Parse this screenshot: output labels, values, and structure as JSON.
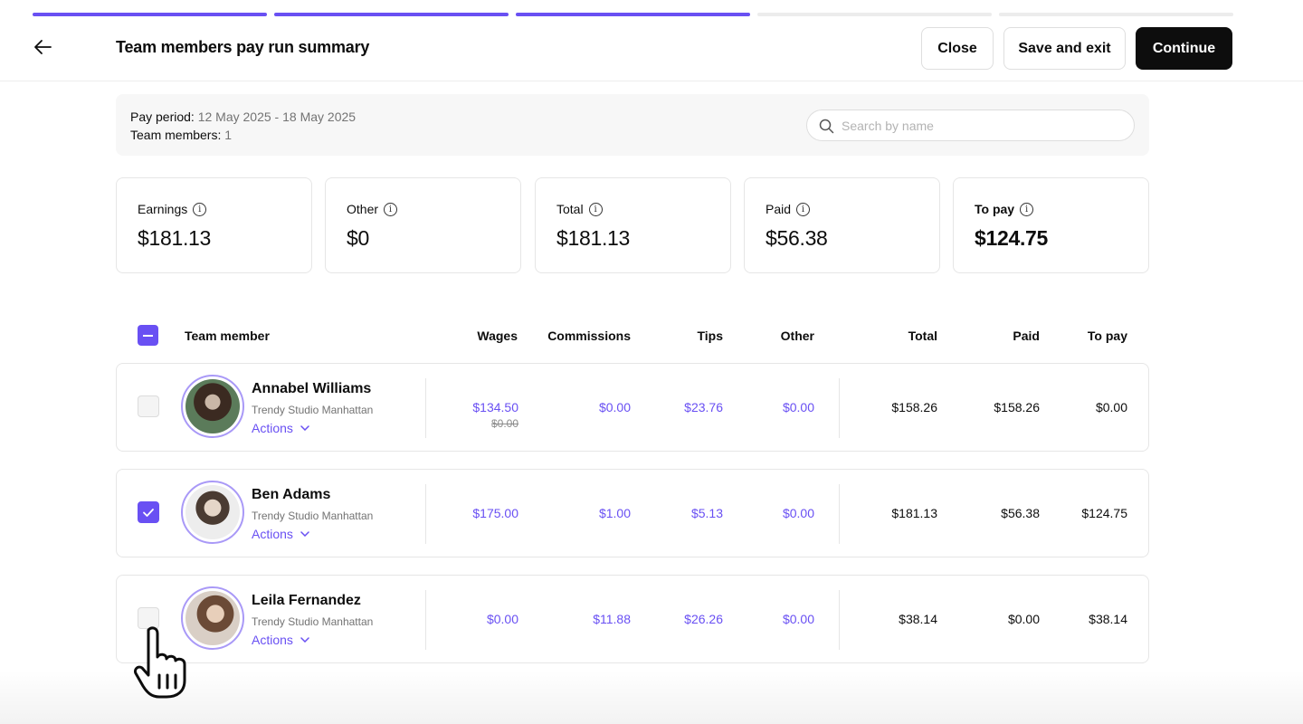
{
  "progress": {
    "total_steps": 5,
    "completed_steps": 3,
    "accent": "#6950f3"
  },
  "header": {
    "title": "Team members pay run summary",
    "back_icon": "arrow-left-icon",
    "close_label": "Close",
    "save_label": "Save and exit",
    "continue_label": "Continue"
  },
  "info": {
    "pay_period_label": "Pay period:",
    "pay_period_value": "12 May 2025 - 18 May 2025",
    "team_members_label": "Team members:",
    "team_members_value": "1",
    "search_placeholder": "Search by name"
  },
  "summary": [
    {
      "label": "Earnings",
      "value": "$181.13"
    },
    {
      "label": "Other",
      "value": "$0"
    },
    {
      "label": "Total",
      "value": "$181.13"
    },
    {
      "label": "Paid",
      "value": "$56.38"
    },
    {
      "label": "To pay",
      "value": "$124.75"
    }
  ],
  "table": {
    "columns": [
      "Team member",
      "Wages",
      "Commissions",
      "Tips",
      "Other",
      "Total",
      "Paid",
      "To pay"
    ],
    "rows": [
      {
        "checked": false,
        "name": "Annabel Williams",
        "location": "Trendy Studio Manhattan",
        "actions": "Actions",
        "wages": "$134.50",
        "wages_original": "$0.00",
        "commissions": "$0.00",
        "tips": "$23.76",
        "other": "$0.00",
        "total": "$158.26",
        "paid": "$158.26",
        "to_pay": "$0.00"
      },
      {
        "checked": true,
        "name": "Ben Adams",
        "location": "Trendy Studio Manhattan",
        "actions": "Actions",
        "wages": "$175.00",
        "commissions": "$1.00",
        "tips": "$5.13",
        "other": "$0.00",
        "total": "$181.13",
        "paid": "$56.38",
        "to_pay": "$124.75"
      },
      {
        "checked": false,
        "name": "Leila Fernandez",
        "location": "Trendy Studio Manhattan",
        "actions": "Actions",
        "wages": "$0.00",
        "commissions": "$11.88",
        "tips": "$26.26",
        "other": "$0.00",
        "total": "$38.14",
        "paid": "$0.00",
        "to_pay": "$38.14"
      }
    ]
  }
}
